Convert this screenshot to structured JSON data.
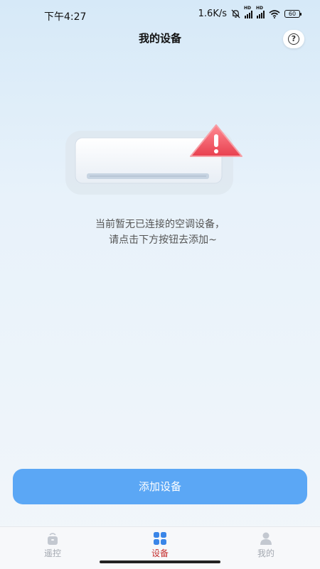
{
  "status_bar": {
    "time": "下午4:27",
    "network_speed": "1.6K/s",
    "battery": "60",
    "icons": [
      "mute-icon",
      "signal-hd-icon",
      "signal-hd-icon",
      "wifi-icon",
      "battery-icon"
    ]
  },
  "header": {
    "title": "我的设备",
    "help_icon": "question-circle-icon"
  },
  "empty_state": {
    "illustration": "air-conditioner-warning-icon",
    "line1": "当前暂无已连接的空调设备，",
    "line2": "请点击下方按钮去添加~"
  },
  "actions": {
    "add_device": "添加设备"
  },
  "tabs": [
    {
      "label": "遥控",
      "icon": "remote-icon",
      "active": false
    },
    {
      "label": "设备",
      "icon": "grid-icon",
      "active": true
    },
    {
      "label": "我的",
      "icon": "profile-icon",
      "active": false
    }
  ],
  "colors": {
    "primary_button": "#5ba7f5",
    "active_tab": "#c5302f",
    "active_tab_icon": "#3a86e8",
    "warning": "#f05a6a"
  }
}
